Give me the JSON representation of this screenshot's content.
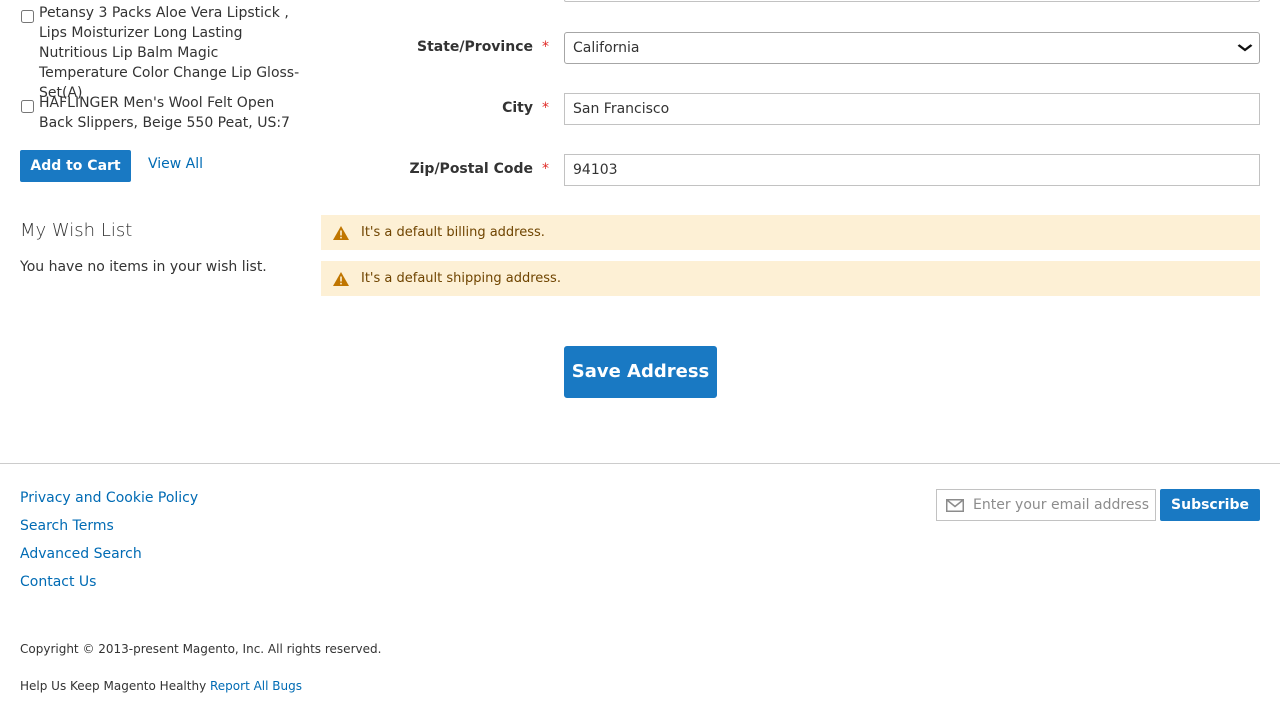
{
  "sidebar": {
    "compare_items": [
      {
        "label": "Petansy 3 Packs Aloe Vera Lipstick , Lips Moisturizer Long Lasting Nutritious Lip Balm Magic Temperature Color Change Lip Gloss-Set(A)"
      },
      {
        "label": "HAFLINGER Men's Wool Felt Open Back Slippers, Beige 550 Peat, US:7"
      }
    ],
    "add_to_cart_label": "Add to Cart",
    "view_all_label": "View All",
    "wishlist_title": "My Wish List",
    "wishlist_empty": "You have no items in your wish list."
  },
  "form": {
    "state": {
      "label": "State/Province",
      "value": "California"
    },
    "city": {
      "label": "City",
      "value": "San Francisco"
    },
    "zip": {
      "label": "Zip/Postal Code",
      "value": "94103"
    },
    "required_mark": "*",
    "notices": [
      {
        "text": "It's a default billing address."
      },
      {
        "text": "It's a default shipping address."
      }
    ],
    "save_label": "Save Address"
  },
  "footer": {
    "links": [
      {
        "label": "Privacy and Cookie Policy"
      },
      {
        "label": "Search Terms"
      },
      {
        "label": "Advanced Search"
      },
      {
        "label": "Contact Us"
      }
    ],
    "newsletter": {
      "placeholder": "Enter your email address",
      "subscribe_label": "Subscribe"
    },
    "copyright": "Copyright © 2013-present Magento, Inc. All rights reserved.",
    "help_prefix": "Help Us Keep Magento Healthy",
    "report_bugs_label": "Report All Bugs"
  },
  "colors": {
    "primary": "#1979c3",
    "link": "#006bb4",
    "notice_bg": "#fdf0d5",
    "notice_text": "#6f4400",
    "required": "#e02b27"
  },
  "icons": {
    "warning": "warning-icon",
    "envelope": "envelope-icon",
    "chevron": "chevron-down-icon"
  }
}
